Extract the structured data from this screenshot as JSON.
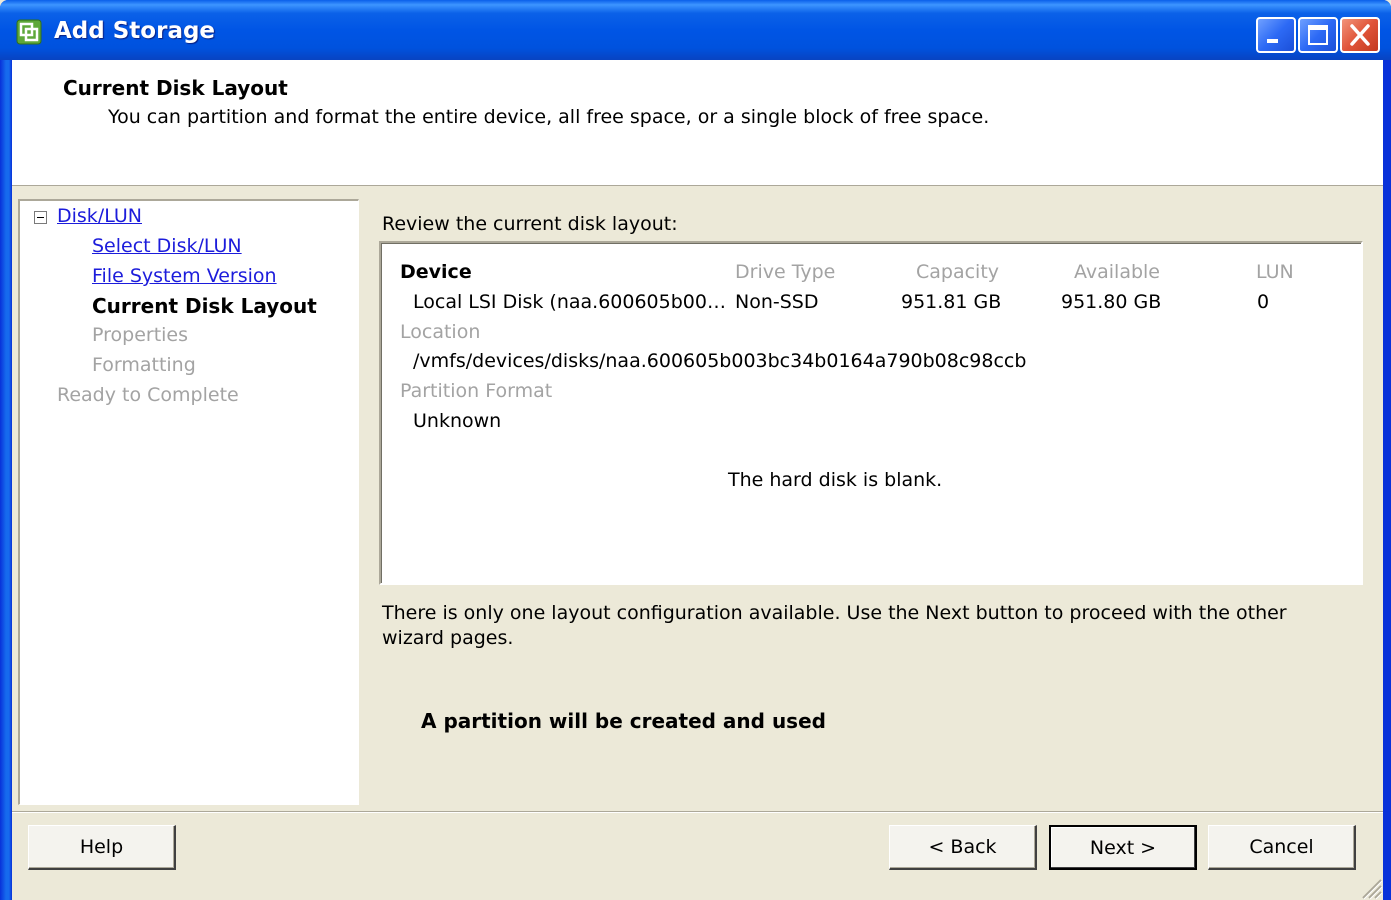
{
  "window": {
    "title": "Add Storage"
  },
  "header": {
    "title": "Current Disk Layout",
    "subtitle": "You can partition and format the entire device, all free space, or a single block of free space."
  },
  "nav": {
    "root": "Disk/LUN",
    "items": [
      {
        "label": "Select Disk/LUN",
        "state": "link"
      },
      {
        "label": "File System Version",
        "state": "link"
      },
      {
        "label": "Current Disk Layout",
        "state": "current"
      },
      {
        "label": "Properties",
        "state": "disabled"
      },
      {
        "label": "Formatting",
        "state": "disabled"
      }
    ],
    "last": "Ready to Complete"
  },
  "main": {
    "review_label": "Review the current disk layout:",
    "columns": {
      "device": "Device",
      "drive_type": "Drive Type",
      "capacity": "Capacity",
      "available": "Available",
      "lun": "LUN"
    },
    "row": {
      "device": "Local LSI Disk (naa.600605b00…",
      "drive_type": "Non-SSD",
      "capacity": "951.81 GB",
      "available": "951.80 GB",
      "lun": "0"
    },
    "location_label": "Location",
    "location_value": "/vmfs/devices/disks/naa.600605b003bc34b0164a790b08c98ccb",
    "partition_format_label": "Partition Format",
    "partition_format_value": "Unknown",
    "blank_message": "The hard disk is blank.",
    "info_text": "There is only one layout configuration available. Use the Next button to proceed with the other wizard pages.",
    "partition_note": "A partition will be created and used"
  },
  "buttons": {
    "help": "Help",
    "back": "< Back",
    "next": "Next >",
    "cancel": "Cancel"
  }
}
